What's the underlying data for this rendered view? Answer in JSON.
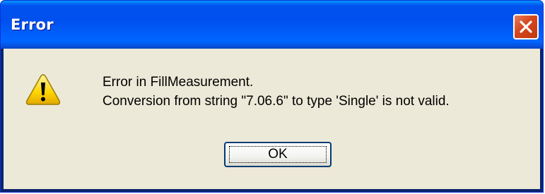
{
  "window": {
    "title": "Error",
    "close_icon": "close-x-icon"
  },
  "dialog": {
    "icon": "warning-icon",
    "message_line1": "Error in FillMeasurement.",
    "message_line2": "Conversion from string \"7.06.6\" to type 'Single' is not valid.",
    "ok_label": "OK"
  },
  "colors": {
    "titlebar_blue": "#0053ee",
    "close_red": "#d4461e",
    "client_bg": "#ece9d8",
    "warning_yellow": "#ffd700"
  }
}
